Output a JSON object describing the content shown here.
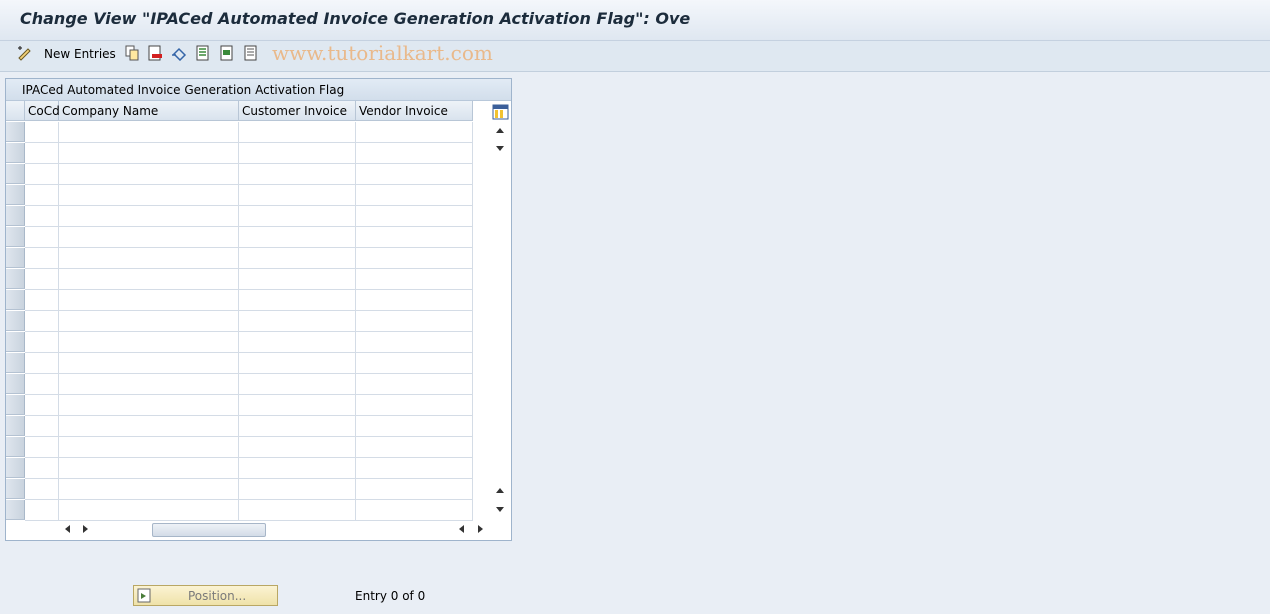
{
  "window": {
    "title": "Change View \"IPACed Automated Invoice Generation Activation Flag\": Ove"
  },
  "toolbar": {
    "new_entries_label": "New Entries",
    "watermark": "www.tutorialkart.com"
  },
  "table": {
    "title": "IPACed Automated Invoice Generation Activation Flag",
    "columns": [
      "CoCd",
      "Company Name",
      "Customer Invoice",
      "Vendor Invoice"
    ],
    "rows": []
  },
  "footer": {
    "position_button": "Position...",
    "entry_text": "Entry 0 of 0"
  }
}
